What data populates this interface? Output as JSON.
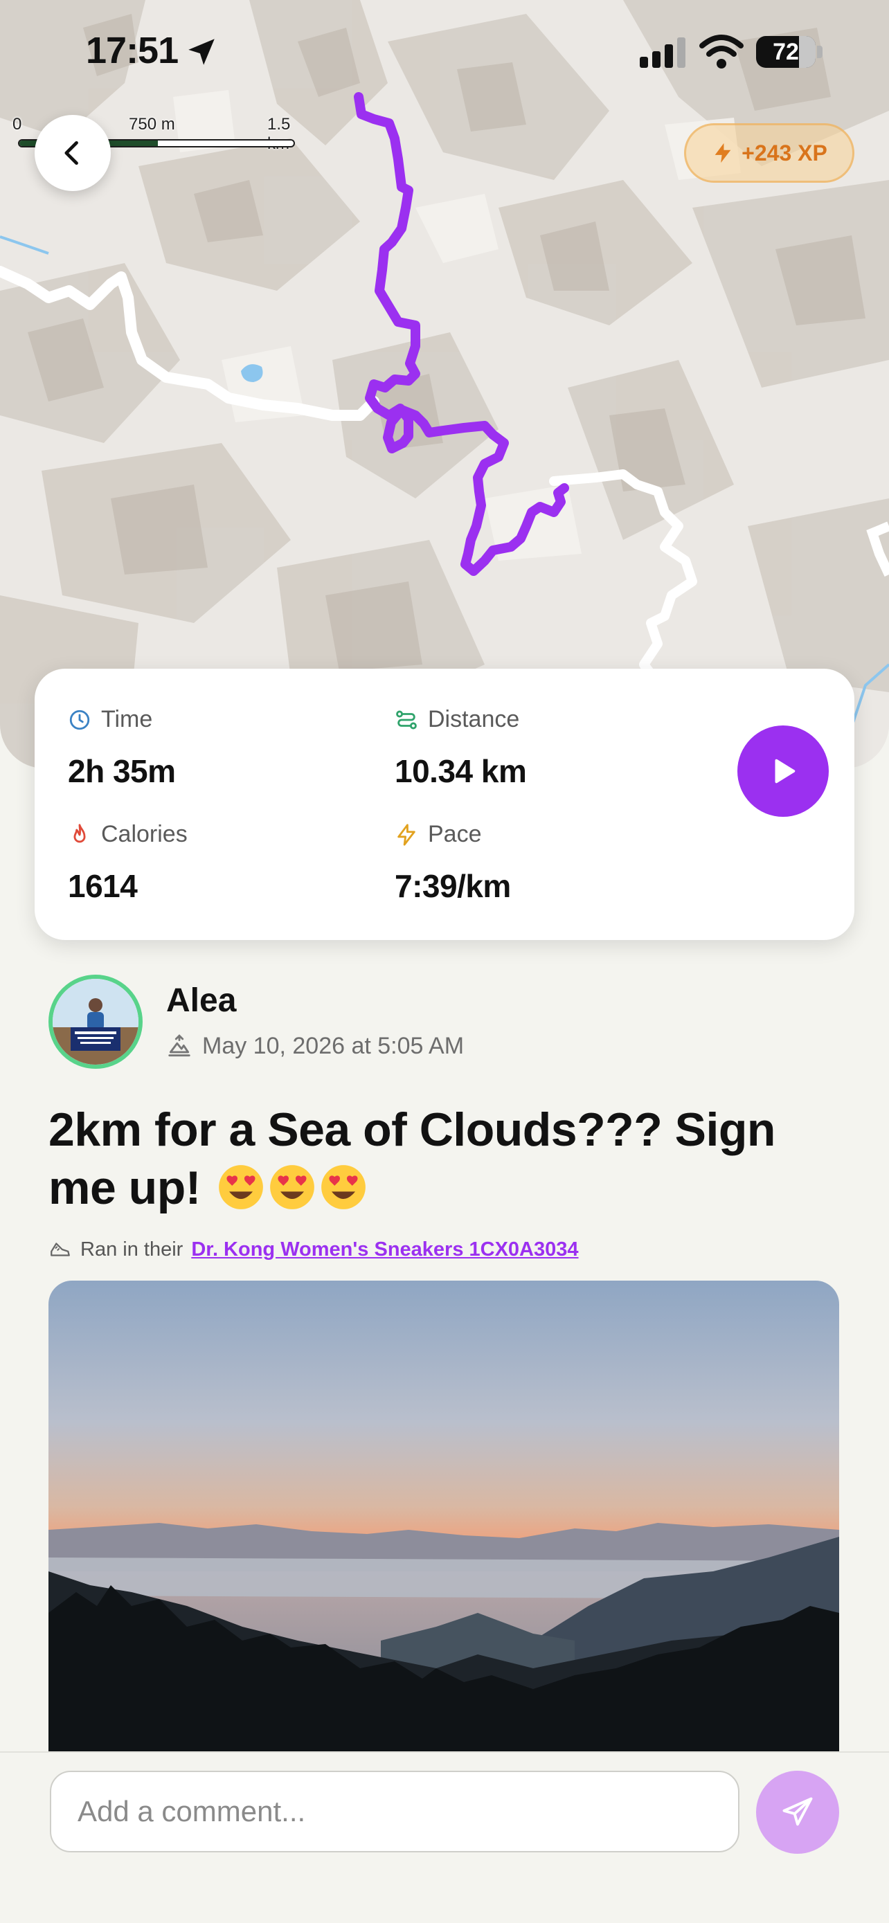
{
  "status_bar": {
    "time": "17:51",
    "battery": "72"
  },
  "map": {
    "scale_labels": [
      "0",
      "750 m",
      "1.5 km"
    ],
    "xp_badge": "+243 XP",
    "route_color": "#9b30f0"
  },
  "stats": {
    "time": {
      "label": "Time",
      "value": "2h 35m",
      "icon": "clock-icon"
    },
    "distance": {
      "label": "Distance",
      "value": "10.34 km",
      "icon": "route-icon"
    },
    "calories": {
      "label": "Calories",
      "value": "1614",
      "icon": "flame-icon"
    },
    "pace": {
      "label": "Pace",
      "value": "7:39/km",
      "icon": "bolt-icon"
    }
  },
  "post": {
    "user_name": "Alea",
    "date": "May 10, 2026 at 5:05 AM",
    "title": "2km for a Sea of Clouds??? Sign me up!",
    "gear_prefix": "Ran in their",
    "gear_link": "Dr. Kong Women's Sneakers 1CX0A3034"
  },
  "comment": {
    "placeholder": "Add a comment..."
  },
  "colors": {
    "accent": "#9b30f0",
    "xp": "#d9741b",
    "avatar_ring": "#58d38a"
  }
}
